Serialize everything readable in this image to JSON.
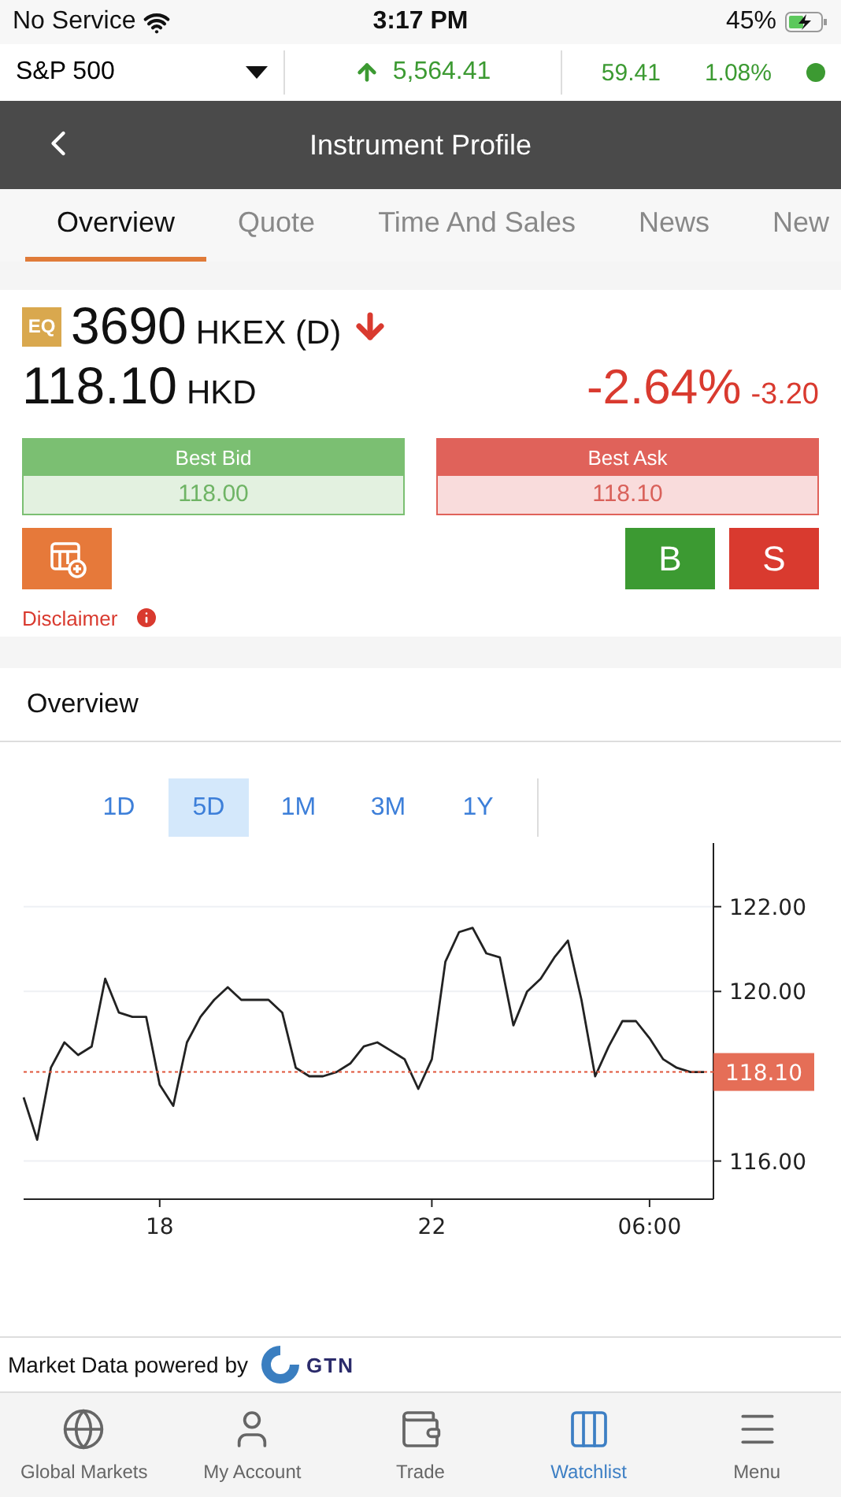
{
  "status_bar": {
    "carrier": "No Service",
    "time": "3:17 PM",
    "battery": "45%"
  },
  "index_ticker": {
    "name": "S&P 500",
    "value": "5,564.41",
    "rising": true,
    "change": "59.41",
    "change_percent": "1.08%",
    "market_open": true
  },
  "header": {
    "title": "Instrument Profile"
  },
  "tabs": [
    {
      "label": "Overview",
      "selected": true
    },
    {
      "label": "Quote",
      "selected": false
    },
    {
      "label": "Time And Sales",
      "selected": false
    },
    {
      "label": "News",
      "selected": false
    },
    {
      "label": "New",
      "selected": false
    }
  ],
  "instrument": {
    "type_badge": "EQ",
    "symbol": "3690",
    "exchange": "HKEX (D)",
    "rising": false,
    "price": "118.10",
    "currency": "HKD",
    "change_percent": "-2.64%",
    "change": "-3.20"
  },
  "best_bid": {
    "label": "Best Bid",
    "value": "118.00"
  },
  "best_ask": {
    "label": "Best Ask",
    "value": "118.10"
  },
  "trade_buttons": [
    {
      "label": "B",
      "kind": "buy"
    },
    {
      "label": "S",
      "kind": "sell"
    }
  ],
  "disclaimer": "Disclaimer",
  "overview": {
    "title": "Overview",
    "ranges": [
      {
        "label": "1D",
        "selected": false
      },
      {
        "label": "5D",
        "selected": true
      },
      {
        "label": "1M",
        "selected": false
      },
      {
        "label": "3M",
        "selected": false
      },
      {
        "label": "1Y",
        "selected": false
      }
    ],
    "chart_data": {
      "type": "line",
      "categories": [
        null,
        null,
        null,
        null,
        null,
        null,
        null,
        null,
        null,
        null,
        "18",
        null,
        null,
        null,
        null,
        null,
        null,
        null,
        null,
        null,
        null,
        null,
        null,
        null,
        null,
        null,
        null,
        null,
        null,
        null,
        "22",
        null,
        null,
        null,
        null,
        null,
        null,
        null,
        null,
        null,
        null,
        null,
        null,
        null,
        null,
        null,
        "06:00",
        null,
        null,
        null,
        null
      ],
      "series": [
        {
          "color": "#222222",
          "values": [
            117.5,
            116.5,
            118.2,
            118.8,
            118.5,
            118.7,
            120.3,
            119.5,
            119.4,
            119.4,
            117.8,
            117.3,
            118.8,
            119.4,
            119.8,
            120.1,
            119.8,
            119.8,
            119.8,
            119.5,
            118.2,
            118.0,
            118.0,
            118.1,
            118.3,
            118.7,
            118.8,
            118.6,
            118.4,
            117.7,
            118.4,
            120.7,
            121.4,
            121.5,
            120.9,
            120.8,
            119.2,
            120.0,
            120.3,
            120.8,
            121.2,
            119.8,
            118.0,
            118.7,
            119.3,
            119.3,
            118.9,
            118.4,
            118.2,
            118.1,
            118.1
          ]
        }
      ],
      "ylim": [
        115.1,
        123.5
      ],
      "grid": true,
      "ref_lines": [
        {
          "axis": "y",
          "value": 118.1,
          "label": "118.10",
          "color": "#e0553a"
        }
      ],
      "yticks": [
        {
          "value": 116,
          "label": "116.00"
        },
        {
          "value": 120,
          "label": "120.00"
        },
        {
          "value": 122,
          "label": "122.00"
        }
      ]
    }
  },
  "footer": {
    "text": "Market Data powered by",
    "logo": "GTN"
  },
  "bottom_nav": [
    {
      "label": "Global Markets",
      "selected": false
    },
    {
      "label": "My Account",
      "selected": false
    },
    {
      "label": "Trade",
      "selected": false
    },
    {
      "label": "Watchlist",
      "selected": true
    },
    {
      "label": "Menu",
      "selected": false
    }
  ]
}
